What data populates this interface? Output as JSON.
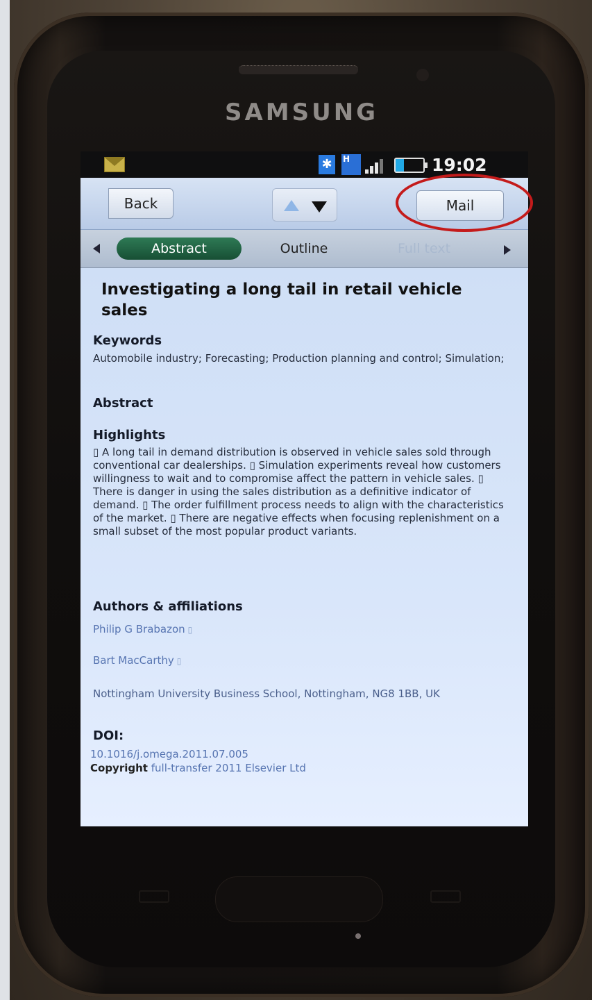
{
  "device": {
    "brand": "SAMSUNG"
  },
  "status_bar": {
    "time": "19:02",
    "bt_icon": "✱",
    "network_label": "H"
  },
  "toolbar": {
    "back_label": "Back",
    "mail_label": "Mail"
  },
  "tabs": {
    "abstract": "Abstract",
    "outline": "Outline",
    "fulltext": "Full text"
  },
  "article": {
    "title": "Investigating a long tail in retail vehicle sales",
    "keywords_heading": "Keywords",
    "keywords": "Automobile industry; Forecasting; Production planning and control; Simulation;",
    "abstract_heading": "Abstract",
    "highlights_heading": "Highlights",
    "highlights": "▯ A long tail in demand distribution is observed in vehicle sales sold through conventional car dealerships. ▯ Simulation experiments reveal how customers willingness to wait and to compromise affect the pattern in vehicle sales. ▯ There is danger in using the sales distribution as a definitive indicator of demand. ▯ The order fulfillment process needs to align with the characteristics of the market. ▯ There are negative effects when focusing replenishment on a small subset of the most popular product variants.",
    "authors_heading": "Authors & affiliations",
    "author1": "Philip G Brabazon",
    "author2": "Bart MacCarthy",
    "author_marker": "▯",
    "affiliation": "Nottingham University Business School, Nottingham, NG8 1BB, UK",
    "doi_heading": "DOI:",
    "doi": "10.1016/j.omega.2011.07.005",
    "copyright_label": "Copyright",
    "copyright_text": "full-transfer 2011 Elsevier Ltd"
  },
  "colors": {
    "annotation": "#c41b1b",
    "tab_active": "#1f6442",
    "screen_bg": "#d6e4f9"
  }
}
